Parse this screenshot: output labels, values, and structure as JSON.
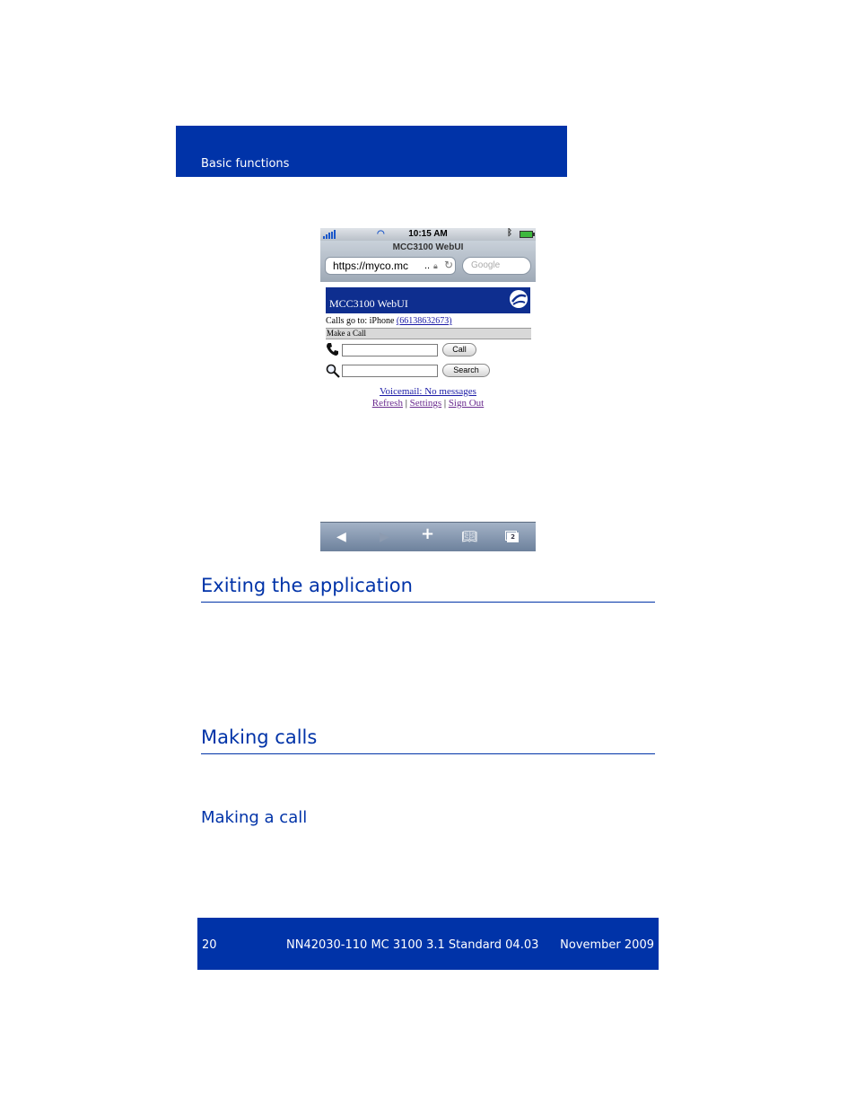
{
  "header": {
    "section": "Basic functions"
  },
  "phone": {
    "status": {
      "time": "10:15 AM"
    },
    "browser": {
      "page_title": "MCC3100 WebUI",
      "url": "https://myco.mc",
      "url_ellipsis": "..",
      "search_placeholder": "Google"
    },
    "webui": {
      "banner_title": "MCC3100 WebUI",
      "calls_go_to_label": "Calls go to: iPhone ",
      "calls_go_to_number": "(6613863267З)",
      "make_call_label": "Make a Call",
      "call_button": "Call",
      "search_button": "Search",
      "voicemail_link": "Voicemail: No messages",
      "refresh_link": "Refresh",
      "separator": " | ",
      "settings_link": "Settings",
      "signout_link": "Sign Out"
    },
    "toolbar": {
      "tabs_count": "2"
    }
  },
  "headings": {
    "exiting": "Exiting the application",
    "making_calls": "Making calls",
    "making_a_call": "Making a call"
  },
  "footer": {
    "page_number": "20",
    "doc_id": "NN42030-110 MC 3100 3.1 Standard 04.03",
    "date": "November 2009"
  },
  "colors": {
    "brand_blue": "#0033a8",
    "webui_banner": "#0e2e8f"
  }
}
